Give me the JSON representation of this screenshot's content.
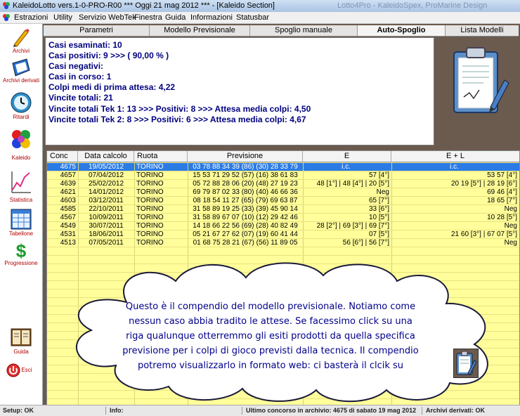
{
  "window": {
    "title": "KaleidoLotto vers.1-0-PRO-R00  ***  Oggi 21 mag 2012  ***   - [Kaleido Section]",
    "ghost_text": "Lotto4Pro - KaleidoSpex, ProMarine Design"
  },
  "menu": {
    "items": [
      "Estrazioni",
      "Utility",
      "Servizio WebTek",
      "Finestra",
      "Guida",
      "Informazioni",
      "Statusbar"
    ]
  },
  "sidebar": {
    "items": [
      {
        "label": "Archivi",
        "icon": "pencil-icon"
      },
      {
        "label": "Archivi derivati",
        "icon": "book-icon"
      },
      {
        "label": "Ritardi",
        "icon": "clock-icon"
      },
      {
        "label": "Kaleido",
        "icon": "kaleido-icon"
      },
      {
        "label": "Statistica",
        "icon": "chart-icon"
      },
      {
        "label": "Tabellone",
        "icon": "calendar-icon"
      },
      {
        "label": "Progressione",
        "icon": "dollar-icon"
      },
      {
        "label": "Guida",
        "icon": "guide-book-icon"
      },
      {
        "label": "Esci",
        "icon": "exit-icon"
      }
    ]
  },
  "tabs": [
    "Parametri",
    "Modello Previsionale",
    "Spoglio manuale",
    "Auto-Spoglio",
    "Lista Modelli"
  ],
  "active_tab": "Auto-Spoglio",
  "summary": [
    "Casi esaminati: 10",
    "Casi positivi: 9 >>> ( 90,00 % )",
    "Casi negativi:",
    "Casi in corso: 1",
    "Colpi medi di prima attesa: 4,22",
    "Vincite totali: 21",
    "Vincite totali Tek 1: 13 >>> Positivi: 8 >>> Attesa media colpi: 4,50",
    "Vincite totali Tek 2: 8 >>> Positivi: 6 >>> Attesa media colpi: 4,67"
  ],
  "table": {
    "columns": [
      "Conc",
      "Data calcolo",
      "Ruota",
      "Previsione",
      "E",
      "E + L"
    ],
    "rows": [
      [
        "4675",
        "19/05/2012",
        "TORINO",
        "03 78 88 34 39 (86) (30) 28 33 79",
        "i.c.",
        "i.c."
      ],
      [
        "4657",
        "07/04/2012",
        "TORINO",
        "15 53 71 29 52 (57) (16) 38 61 83",
        "57 [4°]",
        "53 57 [4°]"
      ],
      [
        "4639",
        "25/02/2012",
        "TORINO",
        "05 72 88 28 06 (20) (48) 27 19 23",
        "48 [1°] | 48 [4°] | 20 [5°]",
        "20 19 [5°] | 28 19 [6°]"
      ],
      [
        "4621",
        "14/01/2012",
        "TORINO",
        "69 79 87 02 33 (80) (40) 46 66 36",
        "Neg",
        "69 46 [4°]"
      ],
      [
        "4603",
        "03/12/2011",
        "TORINO",
        "08 18 54 11 27 (65) (79) 69 63 87",
        "65 [7°]",
        "18 65 [7°]"
      ],
      [
        "4585",
        "22/10/2011",
        "TORINO",
        "31 58 89 19 25 (33) (39) 45 90 14",
        "33 [6°]",
        "Neg"
      ],
      [
        "4567",
        "10/09/2011",
        "TORINO",
        "31 58 89 67 07 (10) (12) 29 42 46",
        "10 [5°]",
        "10 28 [5°]"
      ],
      [
        "4549",
        "30/07/2011",
        "TORINO",
        "14 18 66 22 56 (69) (28) 40 82 49",
        "28 [2°] | 69 [3°] | 69 [7°]",
        "Neg"
      ],
      [
        "4531",
        "18/06/2011",
        "TORINO",
        "05 21 67 27 62 (07) (19) 60 41 44",
        "07 [5°]",
        "21 60 [3°] | 67 07 [5°]"
      ],
      [
        "4513",
        "07/05/2011",
        "TORINO",
        "01 68 75 28 21 (67) (56) 11 89 05",
        "56 [6°] | 56 [7°]",
        "Neg"
      ]
    ]
  },
  "balloon": {
    "lines": [
      "Questo è il compendio del modello previsionale. Notiamo come",
      "nessun caso abbia tradito le attese. Se facessimo click su una",
      "riga qualunque otterremmo gli esiti prodotti da quella specifica",
      "previsione per i colpi di gioco previsti dalla tecnica. Il compendio",
      "potremo visualizzarlo in formato web: ci basterà il clcik su"
    ]
  },
  "statusbar": {
    "setup": "Setup: OK",
    "info": "Info:",
    "last": "Ultimo concorso in archivio: 4675 di sabato 19 mag 2012",
    "derived": "Archivi derivati: OK"
  },
  "colors": {
    "selected_row": "#2b7be5",
    "grid_bg": "#fffe9a",
    "summary_text": "#000080",
    "balloon_text": "#00008a"
  }
}
